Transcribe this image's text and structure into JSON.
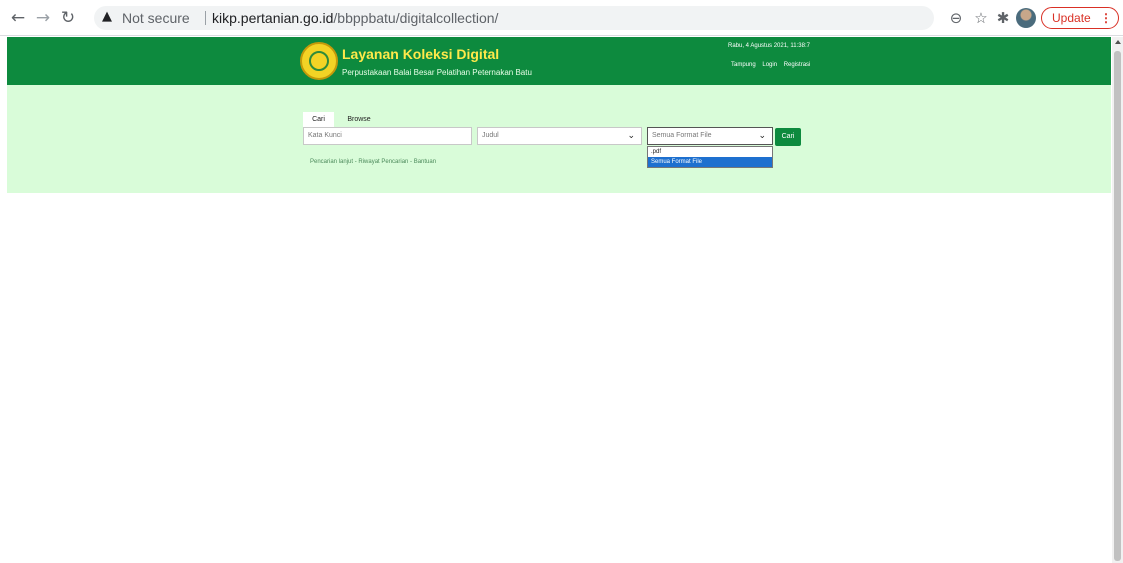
{
  "browser": {
    "security_label": "Not secure",
    "url_host": "kikp.pertanian.go.id",
    "url_path": "/bbppbatu/digitalcollection/",
    "update_label": "Update",
    "icons": [
      "back-icon",
      "forward-icon",
      "reload-icon",
      "warning-icon",
      "zoom-icon",
      "star-icon",
      "extensions-icon",
      "profile-avatar",
      "menu-icon"
    ]
  },
  "header": {
    "title": "Layanan Koleksi Digital",
    "subtitle": "Perpustakaan Balai Besar Pelatihan Peternakan Batu",
    "datetime": "Rabu, 4 Agustus 2021, 11:38:7",
    "links": [
      "Tampung",
      "Login",
      "Registrasi"
    ]
  },
  "search": {
    "tabs": [
      "Cari",
      "Browse"
    ],
    "keyword_placeholder": "Kata Kunci",
    "field_select": "Judul",
    "format_select": "Semua Format File",
    "format_options": [
      ".pdf",
      "Semua Format File"
    ],
    "submit_label": "Cari",
    "sub_links": "Pencarian lanjut - Riwayat Pencarian - Bantuan"
  },
  "colors": {
    "header_green": "#0d8a3e",
    "search_bg": "#d9fcd9",
    "title_yellow": "#ffe94a",
    "highlight_blue": "#1e70cf"
  }
}
